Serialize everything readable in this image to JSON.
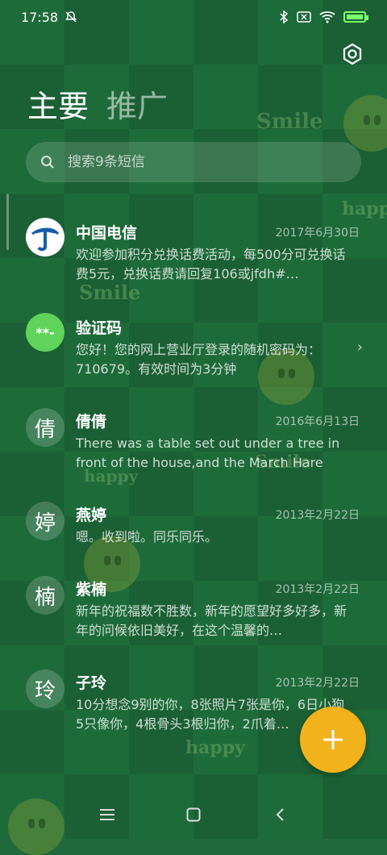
{
  "status_bar": {
    "time": "17:58",
    "icons": [
      "mute-icon",
      "bluetooth-icon",
      "sim-off-icon",
      "wifi-icon",
      "battery-charging-icon"
    ]
  },
  "tabs": [
    {
      "label": "主要",
      "active": true
    },
    {
      "label": "推广",
      "active": false
    }
  ],
  "search": {
    "placeholder": "搜索9条短信"
  },
  "decor": [
    "Smile",
    "happy",
    "Smile",
    "Smile",
    "happy",
    "happy"
  ],
  "messages": [
    {
      "name": "中国电信",
      "date": "2017年6月30日",
      "avatar": "telecom-logo",
      "preview": "欢迎参加积分兑换话费活动，每500分可兑换话费5元，兑换话费请回复106或jfdh#…"
    },
    {
      "name": "验证码",
      "date": "",
      "avatar_text": "**-",
      "preview": "您好！您的网上营业厅登录的随机密码为：710679。有效时间为3分钟"
    },
    {
      "name": "倩倩",
      "date": "2016年6月13日",
      "avatar_text": "倩",
      "preview": "There was a table set out under a tree in front of the house,and the March Hare a…"
    },
    {
      "name": "燕婷",
      "date": "2013年2月22日",
      "avatar_text": "婷",
      "preview": "嗯。收到啦。同乐同乐。"
    },
    {
      "name": "紫楠",
      "date": "2013年2月22日",
      "avatar_text": "楠",
      "preview": "新年的祝福数不胜数，新年的愿望好多好多，新年的问候依旧美好，在这个温馨的…"
    },
    {
      "name": "子玲",
      "date": "2013年2月22日",
      "avatar_text": "玲",
      "preview": "10分想念9别的你，8张照片7张是你，6日小狗5只像你，4根骨头3根归你，2爪着…"
    }
  ],
  "colors": {
    "fab": "#f2b21c",
    "verify_avatar": "#5fd35a",
    "telecom_blue": "#1a5ca8"
  }
}
